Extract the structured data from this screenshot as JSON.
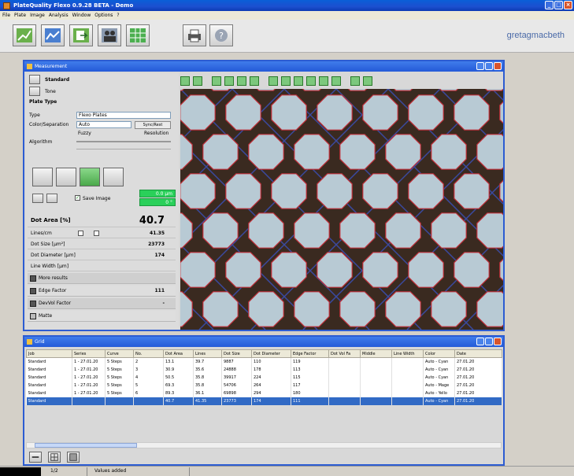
{
  "app": {
    "title": "PlateQuality Flexo 0.9.28 BETA - Demo",
    "brand": "gretagmacbeth"
  },
  "menu": [
    "File",
    "Plate",
    "Image",
    "Analysis",
    "Window",
    "Options",
    "?"
  ],
  "toolbar": {
    "icons": [
      "chart-up-icon",
      "line-chart-icon",
      "export-icon",
      "users-icon",
      "table-icon",
      "print-icon",
      "help-icon"
    ]
  },
  "measurement": {
    "title": "Measurement",
    "standard_label": "Standard",
    "tone_label": "Tone",
    "plate_type_label": "Plate Type",
    "type_label": "Type",
    "type_value": "Flexo Plates",
    "color_label": "Color/Separation",
    "color_value": "Auto",
    "sync_label": "Sync/Rest",
    "fuzzy_label": "Fuzzy",
    "resolution_label": "Resolution",
    "algorithm_label": "Algorithm",
    "save_image_label": "Save Image",
    "green_top": "0.0 μm",
    "green_bottom": "0 °",
    "dot_area_label": "Dot Area [%]",
    "dot_area_value": "40.7",
    "lines_label": "Lines/cm",
    "lines_value": "41.35",
    "dot_size_label": "Dot Size [μm²]",
    "dot_size_value": "23773",
    "dot_diameter_label": "Dot Diameter [μm]",
    "dot_diameter_value": "174",
    "line_width_label": "Line Width [μm]",
    "more_results_label": "More results",
    "edge_factor_label": "Edge Factor",
    "edge_factor_value": "111",
    "devvol_label": "DevVol Factor",
    "devvol_value": "-",
    "matte_label": "Matte"
  },
  "grid": {
    "title": "Grid",
    "columns": [
      "Job",
      "Series",
      "Curve",
      "No.",
      "Dot Area",
      "Lines",
      "Dot Size",
      "Dot Diameter",
      "Edge Factor",
      "Dot Vol Fa",
      "Middle",
      "Line Width",
      "Color",
      "Date"
    ],
    "rows": [
      [
        "Standard",
        "1 - 27.01.20",
        "5 Steps",
        "2",
        "13.1",
        "39.7",
        "9887",
        "110",
        "119",
        "",
        "",
        "",
        "Auto - Cyan",
        "27.01.20"
      ],
      [
        "Standard",
        "1 - 27.01.20",
        "5 Steps",
        "3",
        "30.9",
        "35.6",
        "24888",
        "178",
        "113",
        "",
        "",
        "",
        "Auto - Cyan",
        "27.01.20"
      ],
      [
        "Standard",
        "1 - 27.01.20",
        "5 Steps",
        "4",
        "50.5",
        "35.8",
        "39917",
        "224",
        "115",
        "",
        "",
        "",
        "Auto - Cyan",
        "27.01.20"
      ],
      [
        "Standard",
        "1 - 27.01.20",
        "5 Steps",
        "5",
        "69.3",
        "35.8",
        "54706",
        "264",
        "117",
        "",
        "",
        "",
        "Auto - Mage",
        "27.01.20"
      ],
      [
        "Standard",
        "1 - 27.01.20",
        "5 Steps",
        "6",
        "89.3",
        "36.1",
        "69898",
        "294",
        "180",
        "",
        "",
        "",
        "Auto - Yello",
        "27.01.20"
      ],
      [
        "Standard",
        "",
        "",
        "",
        "40.7",
        "41.35",
        "23773",
        "174",
        "111",
        "",
        "",
        "",
        "Auto - Cyan",
        "27.01.20"
      ]
    ]
  },
  "status": {
    "left": "1/2",
    "msg": "Values added"
  },
  "colors": {
    "title_blue": "#2c5cd2",
    "accent_green": "#2ad05a",
    "selection": "#316ac5",
    "dot_edge": "#c0303a"
  }
}
